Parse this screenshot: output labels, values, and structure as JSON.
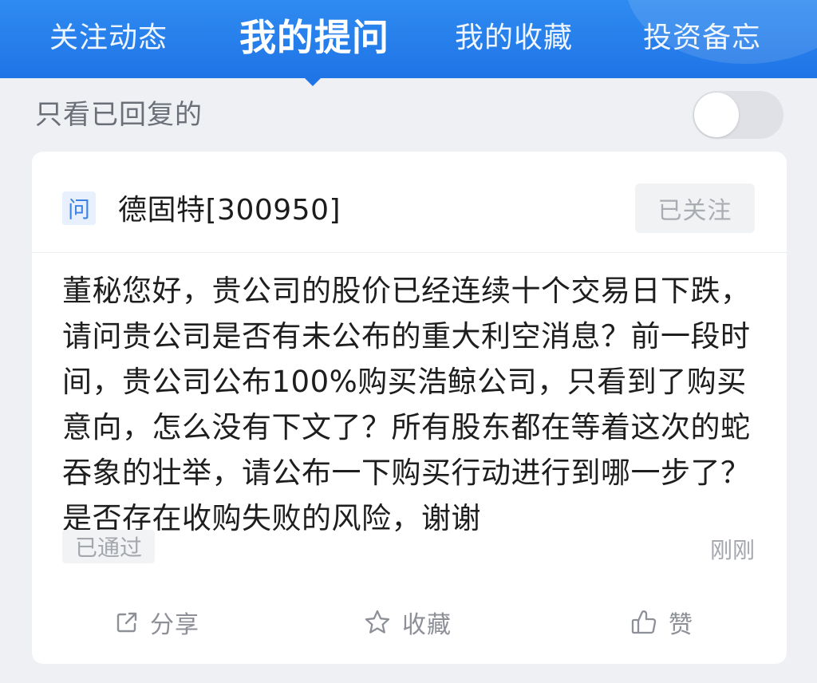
{
  "tabs": [
    {
      "label": "关注动态",
      "active": false
    },
    {
      "label": "我的提问",
      "active": true
    },
    {
      "label": "我的收藏",
      "active": false
    },
    {
      "label": "投资备忘",
      "active": false
    }
  ],
  "filter": {
    "label": "只看已回复的",
    "toggle_on": false
  },
  "card": {
    "badge": "问",
    "stock": "德固特[300950]",
    "follow_label": "已关注",
    "question": "董秘您好，贵公司的股价已经连续十个交易日下跌，请问贵公司是否有未公布的重大利空消息？前一段时间，贵公司公布100%购买浩鲸公司，只看到了购买意向，怎么没有下文了？所有股东都在等着这次的蛇吞象的壮举，请公布一下购买行动进行到哪一步了？是否存在收购失败的风险，谢谢",
    "status": "已通过",
    "time": "刚刚",
    "actions": {
      "share": "分享",
      "favorite": "收藏",
      "like": "赞"
    }
  },
  "colors": {
    "header_blue": "#1f74e6",
    "background": "#eef0f4",
    "badge_blue": "#3b82e6"
  },
  "icons": {
    "share": "share-icon",
    "favorite": "star-icon",
    "like": "thumbs-up-icon"
  }
}
